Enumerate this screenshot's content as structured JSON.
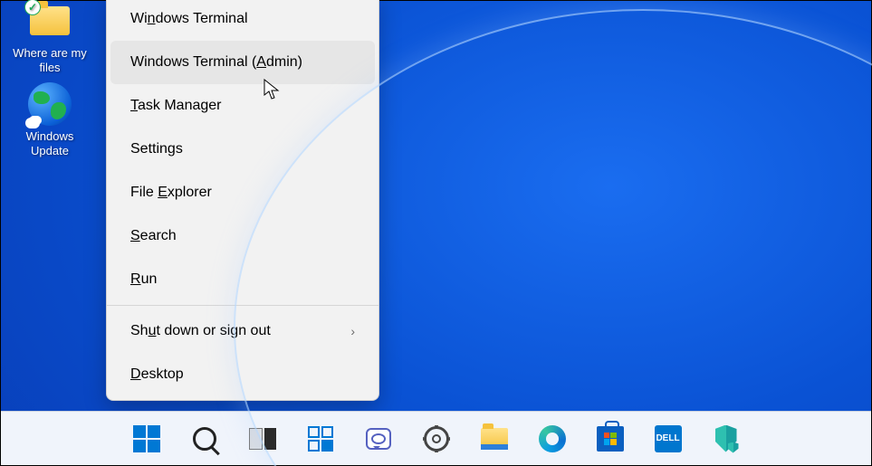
{
  "desktop_icons": [
    {
      "label": "Where are my files",
      "glyph": "folder-icon"
    },
    {
      "label": "Windows Update",
      "glyph": "globe-icon"
    }
  ],
  "winx_pre_html": [
    "Wi<u>n</u>dows Terminal",
    "Windows Terminal (<u>A</u>dmin)",
    "<u>T</u>ask Manager",
    "Settin<u>g</u>s",
    "File <u>E</u>xplorer",
    "<u>S</u>earch",
    "<u>R</u>un"
  ],
  "winx_post_html": [
    "Sh<u>u</u>t down or sign out",
    "<u>D</u>esktop"
  ],
  "winx_hover_index": 1,
  "winx_submenu_index": 0,
  "taskbar_items": [
    "start-button",
    "search-button",
    "task-view-button",
    "widgets-button",
    "chat-button",
    "settings-button",
    "file-explorer-button",
    "edge-button",
    "ms-store-button",
    "dell-button",
    "security-button"
  ]
}
